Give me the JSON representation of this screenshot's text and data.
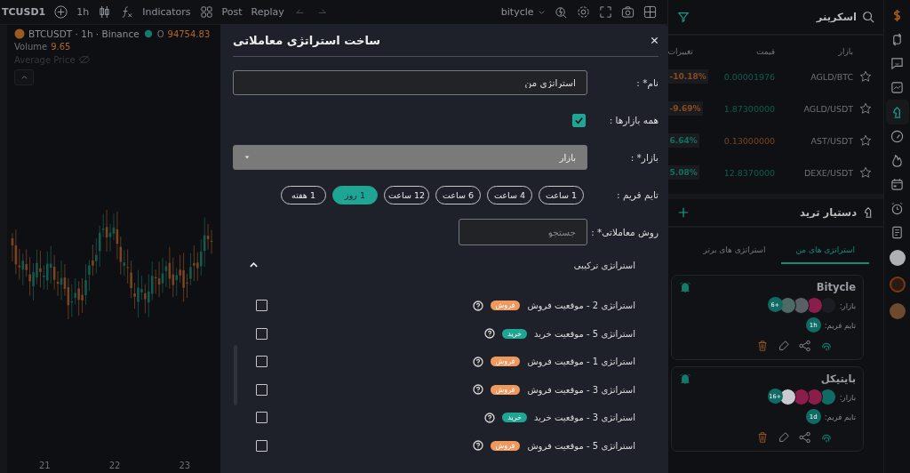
{
  "toolbar": {
    "symbol": "TCUSD1",
    "interval": "1h",
    "indicators": "Indicators",
    "post": "Post",
    "replay": "Replay",
    "layout_name": "bitycle"
  },
  "chart": {
    "title": "BTCUSDT · 1h · Binance",
    "open_label": "O",
    "open_value": "94754.83",
    "volume_label": "Volume",
    "volume_value": "9.65",
    "average_label": "Average Price",
    "x_axis": {
      "left_label": "21",
      "middle_label": "22",
      "right_label": "23"
    }
  },
  "modal": {
    "title": "ساخت استراتژی معاملاتی",
    "name_label": "نام* :",
    "name_value": "استراتژی من",
    "all_markets_label": "همه بازارها :",
    "all_markets_checked": true,
    "market_label": "بازار* :",
    "market_placeholder": "بازار",
    "market_disabled": true,
    "timeframe_label": "تایم فریم :",
    "timeframes": [
      {
        "label": "1 ساعت",
        "selected": false
      },
      {
        "label": "4 ساعت",
        "selected": false
      },
      {
        "label": "6 ساعت",
        "selected": false
      },
      {
        "label": "12 ساعت",
        "selected": false
      },
      {
        "label": "1 روز",
        "selected": true
      },
      {
        "label": "1 هفته",
        "selected": false
      }
    ],
    "method_label": "روش معاملاتی* :",
    "search_placeholder": "جستجو",
    "group": {
      "title": "استراتژی ترکیبی",
      "expanded": true
    },
    "strategies": [
      {
        "name": "استراتژی 2 - موقعیت فروش",
        "tag": "فروش",
        "kind": "sell",
        "checked": false
      },
      {
        "name": "استراتژی 5 - موقعیت خرید",
        "tag": "خرید",
        "kind": "buy",
        "checked": false
      },
      {
        "name": "استراتژی 1 - موقعیت فروش",
        "tag": "فروش",
        "kind": "sell",
        "checked": false
      },
      {
        "name": "استراتژی 3 - موقعیت فروش",
        "tag": "فروش",
        "kind": "sell",
        "checked": false
      },
      {
        "name": "استراتژی 3 - موقعیت خرید",
        "tag": "خرید",
        "kind": "buy",
        "checked": false
      },
      {
        "name": "استراتژی 5 - موقعیت فروش",
        "tag": "فروش",
        "kind": "sell",
        "checked": false
      }
    ]
  },
  "screener": {
    "title": "اسکرینر",
    "columns": [
      "بازار",
      "قیمت",
      "تغییرات"
    ],
    "rows": [
      {
        "market": "AGLD/BTC",
        "price": {
          "text": "0.00001976",
          "color": "#0f5e52"
        },
        "change": {
          "text": "-10.18%",
          "color": "#8a4a22"
        }
      },
      {
        "market": "AGLD/USDT",
        "price": {
          "text": "1.87300000",
          "color": "#0f5e52"
        },
        "change": {
          "text": "-9.69%",
          "color": "#8a4a22"
        }
      },
      {
        "market": "AST/USDT",
        "price": {
          "text": "0.13000000",
          "color": "#7a4420"
        },
        "change": {
          "text": "6.64%",
          "color": "#137062"
        }
      },
      {
        "market": "DEXE/USDT",
        "price": {
          "text": "12.8370000",
          "color": "#0f5e52"
        },
        "change": {
          "text": "5.08%",
          "color": "#137062"
        }
      }
    ]
  },
  "assistant": {
    "title": "دستیار ترید",
    "tabs": [
      {
        "label": "استراتژی های من",
        "selected": true
      },
      {
        "label": "استراتژی های برتر",
        "selected": false
      }
    ],
    "cards": [
      {
        "name": "Bitycle",
        "market_label": "بازار:",
        "timeframe_label": "تایم فریم:",
        "timeframe": "1h",
        "more": "6+",
        "coins": [
          {
            "color": "#1b1d22"
          },
          {
            "color": "#8a1d4a"
          },
          {
            "color": "#5a5f66"
          },
          {
            "color": "#4d6a66"
          }
        ]
      },
      {
        "name": "بایتیکل",
        "market_label": "بازار:",
        "timeframe_label": "تایم فریم:",
        "timeframe": "1d",
        "more": "16+",
        "coins": [
          {
            "color": "#0f6b63"
          },
          {
            "color": "#8a1d4a"
          },
          {
            "color": "#8a1d4a"
          },
          {
            "color": "#c9cbd0"
          }
        ]
      }
    ]
  }
}
